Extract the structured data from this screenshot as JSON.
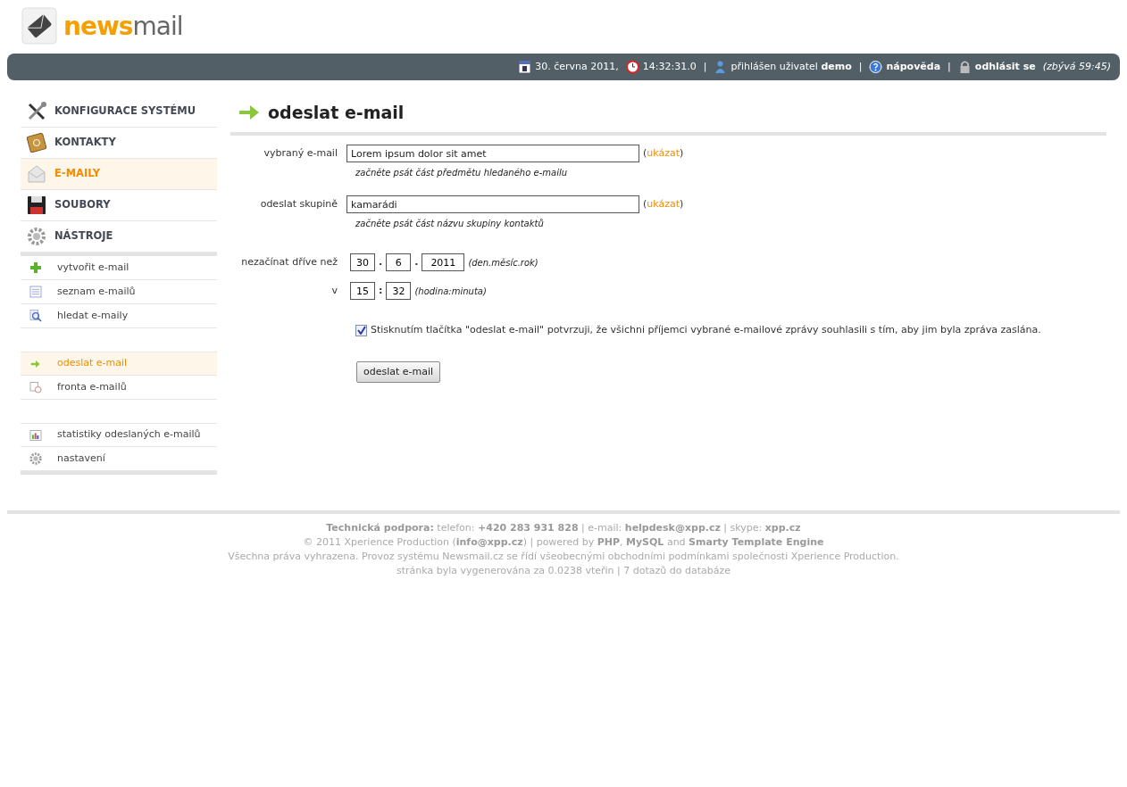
{
  "logo": {
    "part_1": "news",
    "part_2": "mail"
  },
  "top_bar": [
    {
      "kind": "date",
      "text": "30. června 2011,"
    },
    {
      "kind": "time",
      "text": "14:32:31.0"
    },
    {
      "kind": "separator",
      "text": "|"
    },
    {
      "kind": "user",
      "text": "přihlášen uživatel **demo**"
    },
    {
      "kind": "separator",
      "text": "|"
    },
    {
      "kind": "help",
      "text": "nápověda"
    },
    {
      "kind": "separator",
      "text": "|"
    },
    {
      "kind": "logout",
      "text": "odhlásit se",
      "note": "(zbývá 59:45)"
    }
  ],
  "main_menu": [
    {
      "kind": "tools",
      "label": "KONFIGURACE SYSTÉMU",
      "selected": false
    },
    {
      "kind": "book",
      "label": "KONTAKTY",
      "selected": false
    },
    {
      "kind": "envelope",
      "label": "E-MAILY",
      "selected": true
    },
    {
      "kind": "floppy",
      "label": "SOUBORY",
      "selected": false
    },
    {
      "kind": "gear",
      "label": "NÁSTROJE",
      "selected": false
    }
  ],
  "sub_menu": [
    [
      {
        "kind": "plus",
        "label": "vytvořit e-mail",
        "selected": false
      },
      {
        "kind": "list",
        "label": "seznam e-mailů",
        "selected": false
      },
      {
        "kind": "magnifier",
        "label": "hledat e-maily",
        "selected": false
      }
    ],
    [
      {
        "kind": "arrow",
        "label": "odeslat e-mail",
        "selected": true
      },
      {
        "kind": "queue",
        "label": "fronta e-mailů",
        "selected": false
      }
    ],
    [
      {
        "kind": "chart",
        "label": "statistiky odeslaných e-mailů",
        "selected": false
      },
      {
        "kind": "gear",
        "label": "nastavení",
        "selected": false
      }
    ]
  ],
  "page_title": "odeslat e-mail",
  "form": {
    "email": {
      "label": "vybraný e-mail",
      "value": "Lorem ipsum dolor sit amet",
      "link_open": "(",
      "link": "ukázat",
      "link_close": ")",
      "hint": "začněte psát část předmětu hledaného e-mailu"
    },
    "group": {
      "label": "odeslat skupině",
      "value": "kamarádi",
      "link_open": "(",
      "link": "ukázat",
      "link_close": ")",
      "hint": "začněte psát část názvu skupiny kontaktů"
    },
    "date": {
      "label": "nezačínat dříve než",
      "day": "30",
      "dot_1": ".",
      "month": "6",
      "dot_2": ".",
      "year": "2011",
      "format": "(den.měsíc.rok)"
    },
    "time": {
      "label": "v",
      "hour": "15",
      "colon": ":",
      "minute": "32",
      "format": "(hodina:minuta)"
    },
    "consent": {
      "checked": true,
      "label": "Stisknutím tlačítka \"odeslat e-mail\" potvrzuji, že všichni příjemci vybrané e-mailové zprávy souhlasili s tím, aby jim byla zpráva zaslána."
    },
    "submit": "odeslat e-mail"
  },
  "footer": [
    "**Technická podpora:** telefon: **+420 283 931 828** | e-mail: **helpdesk@xpp.cz** | skype: **xpp.cz**",
    "© 2011 Xperience Production (**info@xpp.cz**) | powered by **PHP**, **MySQL** and **Smarty Template Engine**",
    "Všechna práva vyhrazena. Provoz systému Newsmail.cz se řídí všeobecnými obchodními podmínkami společnosti Xperience Production.",
    "stránka byla vygenerována za 0.0238 vteřin | 7 dotazů do databáze"
  ]
}
